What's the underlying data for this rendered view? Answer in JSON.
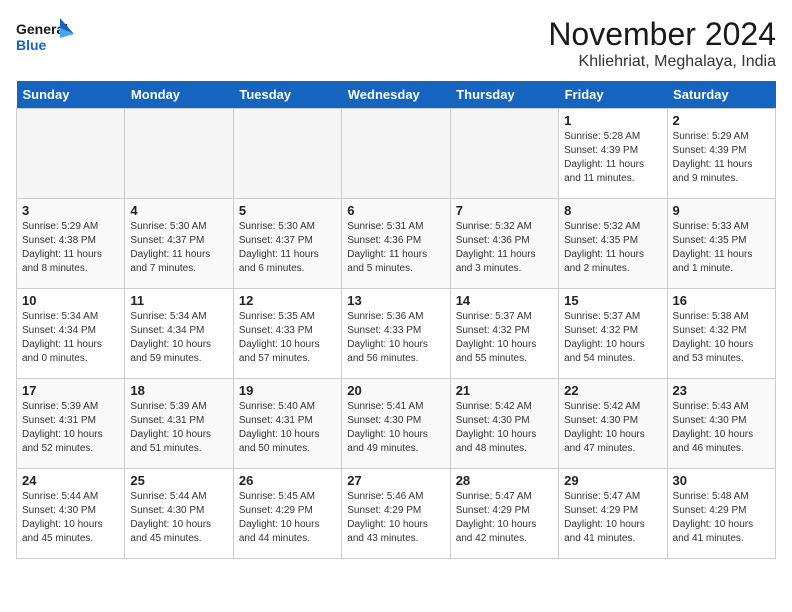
{
  "logo": {
    "text_general": "General",
    "text_blue": "Blue"
  },
  "title": "November 2024",
  "location": "Khliehriat, Meghalaya, India",
  "weekdays": [
    "Sunday",
    "Monday",
    "Tuesday",
    "Wednesday",
    "Thursday",
    "Friday",
    "Saturday"
  ],
  "weeks": [
    [
      {
        "day": "",
        "info": ""
      },
      {
        "day": "",
        "info": ""
      },
      {
        "day": "",
        "info": ""
      },
      {
        "day": "",
        "info": ""
      },
      {
        "day": "",
        "info": ""
      },
      {
        "day": "1",
        "info": "Sunrise: 5:28 AM\nSunset: 4:39 PM\nDaylight: 11 hours\nand 11 minutes."
      },
      {
        "day": "2",
        "info": "Sunrise: 5:29 AM\nSunset: 4:39 PM\nDaylight: 11 hours\nand 9 minutes."
      }
    ],
    [
      {
        "day": "3",
        "info": "Sunrise: 5:29 AM\nSunset: 4:38 PM\nDaylight: 11 hours\nand 8 minutes."
      },
      {
        "day": "4",
        "info": "Sunrise: 5:30 AM\nSunset: 4:37 PM\nDaylight: 11 hours\nand 7 minutes."
      },
      {
        "day": "5",
        "info": "Sunrise: 5:30 AM\nSunset: 4:37 PM\nDaylight: 11 hours\nand 6 minutes."
      },
      {
        "day": "6",
        "info": "Sunrise: 5:31 AM\nSunset: 4:36 PM\nDaylight: 11 hours\nand 5 minutes."
      },
      {
        "day": "7",
        "info": "Sunrise: 5:32 AM\nSunset: 4:36 PM\nDaylight: 11 hours\nand 3 minutes."
      },
      {
        "day": "8",
        "info": "Sunrise: 5:32 AM\nSunset: 4:35 PM\nDaylight: 11 hours\nand 2 minutes."
      },
      {
        "day": "9",
        "info": "Sunrise: 5:33 AM\nSunset: 4:35 PM\nDaylight: 11 hours\nand 1 minute."
      }
    ],
    [
      {
        "day": "10",
        "info": "Sunrise: 5:34 AM\nSunset: 4:34 PM\nDaylight: 11 hours\nand 0 minutes."
      },
      {
        "day": "11",
        "info": "Sunrise: 5:34 AM\nSunset: 4:34 PM\nDaylight: 10 hours\nand 59 minutes."
      },
      {
        "day": "12",
        "info": "Sunrise: 5:35 AM\nSunset: 4:33 PM\nDaylight: 10 hours\nand 57 minutes."
      },
      {
        "day": "13",
        "info": "Sunrise: 5:36 AM\nSunset: 4:33 PM\nDaylight: 10 hours\nand 56 minutes."
      },
      {
        "day": "14",
        "info": "Sunrise: 5:37 AM\nSunset: 4:32 PM\nDaylight: 10 hours\nand 55 minutes."
      },
      {
        "day": "15",
        "info": "Sunrise: 5:37 AM\nSunset: 4:32 PM\nDaylight: 10 hours\nand 54 minutes."
      },
      {
        "day": "16",
        "info": "Sunrise: 5:38 AM\nSunset: 4:32 PM\nDaylight: 10 hours\nand 53 minutes."
      }
    ],
    [
      {
        "day": "17",
        "info": "Sunrise: 5:39 AM\nSunset: 4:31 PM\nDaylight: 10 hours\nand 52 minutes."
      },
      {
        "day": "18",
        "info": "Sunrise: 5:39 AM\nSunset: 4:31 PM\nDaylight: 10 hours\nand 51 minutes."
      },
      {
        "day": "19",
        "info": "Sunrise: 5:40 AM\nSunset: 4:31 PM\nDaylight: 10 hours\nand 50 minutes."
      },
      {
        "day": "20",
        "info": "Sunrise: 5:41 AM\nSunset: 4:30 PM\nDaylight: 10 hours\nand 49 minutes."
      },
      {
        "day": "21",
        "info": "Sunrise: 5:42 AM\nSunset: 4:30 PM\nDaylight: 10 hours\nand 48 minutes."
      },
      {
        "day": "22",
        "info": "Sunrise: 5:42 AM\nSunset: 4:30 PM\nDaylight: 10 hours\nand 47 minutes."
      },
      {
        "day": "23",
        "info": "Sunrise: 5:43 AM\nSunset: 4:30 PM\nDaylight: 10 hours\nand 46 minutes."
      }
    ],
    [
      {
        "day": "24",
        "info": "Sunrise: 5:44 AM\nSunset: 4:30 PM\nDaylight: 10 hours\nand 45 minutes."
      },
      {
        "day": "25",
        "info": "Sunrise: 5:44 AM\nSunset: 4:30 PM\nDaylight: 10 hours\nand 45 minutes."
      },
      {
        "day": "26",
        "info": "Sunrise: 5:45 AM\nSunset: 4:29 PM\nDaylight: 10 hours\nand 44 minutes."
      },
      {
        "day": "27",
        "info": "Sunrise: 5:46 AM\nSunset: 4:29 PM\nDaylight: 10 hours\nand 43 minutes."
      },
      {
        "day": "28",
        "info": "Sunrise: 5:47 AM\nSunset: 4:29 PM\nDaylight: 10 hours\nand 42 minutes."
      },
      {
        "day": "29",
        "info": "Sunrise: 5:47 AM\nSunset: 4:29 PM\nDaylight: 10 hours\nand 41 minutes."
      },
      {
        "day": "30",
        "info": "Sunrise: 5:48 AM\nSunset: 4:29 PM\nDaylight: 10 hours\nand 41 minutes."
      }
    ]
  ]
}
